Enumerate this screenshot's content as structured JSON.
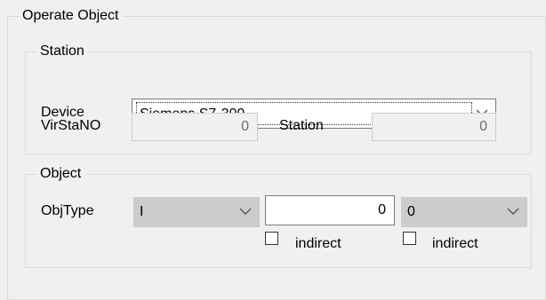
{
  "operate_object": {
    "title": "Operate Object"
  },
  "station_group": {
    "title": "Station",
    "device_label": "Device",
    "device_value": "Siemens S7-300",
    "virstano_label": "VirStaNO",
    "virstano_value": "0",
    "station_label": "Station",
    "station_value": "0"
  },
  "object_group": {
    "title": "Object",
    "objtype_label": "ObjType",
    "objtype_value": "I",
    "address_value": "0",
    "bit_value": "0",
    "indirect_label_1": "indirect",
    "indirect_label_2": "indirect"
  },
  "icons": {
    "dropdown": "chevron-down-icon",
    "checkbox": "checkbox-unchecked-icon"
  },
  "colors": {
    "background": "#f0f0f0",
    "group_border": "#dcdcdc",
    "disabled_fill": "#cccccc",
    "disabled_text": "#6d6d6d"
  }
}
